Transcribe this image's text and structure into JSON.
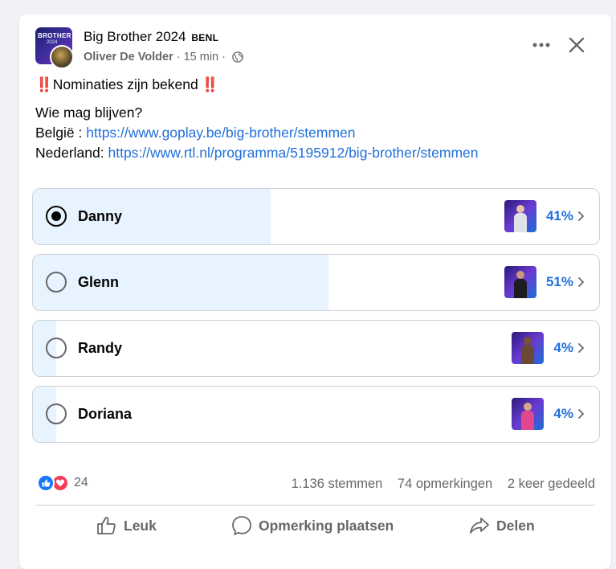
{
  "post": {
    "page_name": "Big Brother 2024",
    "page_tag": "BENL",
    "avatar_brand": "BROTHER",
    "avatar_year": "2024",
    "author": "Oliver De Volder",
    "time": "15 min",
    "separator": "·",
    "title_emoji_left": "‼️",
    "title_text": "Nominaties zijn bekend",
    "title_emoji_right": "‼️",
    "line1": "Wie mag blijven?",
    "line2_label": "België : ",
    "line2_link": "https://www.goplay.be/big-brother/stemmen",
    "line3_label": "Nederland: ",
    "line3_link": "https://www.rtl.nl/programma/5195912/big-brother/stemmen"
  },
  "poll": {
    "options": [
      {
        "label": "Danny",
        "percent": "41%",
        "fraction": 0.41,
        "selected": true
      },
      {
        "label": "Glenn",
        "percent": "51%",
        "fraction": 0.51,
        "selected": false
      },
      {
        "label": "Randy",
        "percent": "4%",
        "fraction": 0.04,
        "selected": false
      },
      {
        "label": "Doriana",
        "percent": "4%",
        "fraction": 0.04,
        "selected": false
      }
    ]
  },
  "stats": {
    "reaction_count": "24",
    "votes": "1.136 stemmen",
    "comments": "74 opmerkingen",
    "shares": "2 keer gedeeld"
  },
  "actions": {
    "like": "Leuk",
    "comment": "Opmerking plaatsen",
    "share": "Delen"
  },
  "colors": {
    "accent_link": "#216fdb",
    "poll_fill": "#e7f3ff",
    "like_blue": "#1877f2",
    "love_red": "#f33e58",
    "title_emoji": "#e02424"
  },
  "icons": {
    "more": "more-horizontal-icon",
    "close": "close-icon",
    "privacy": "globe-icon",
    "option_expand": "chevron-right-icon",
    "like": "thumbs-up-icon",
    "comment": "comment-bubble-icon",
    "share": "share-arrow-icon"
  }
}
